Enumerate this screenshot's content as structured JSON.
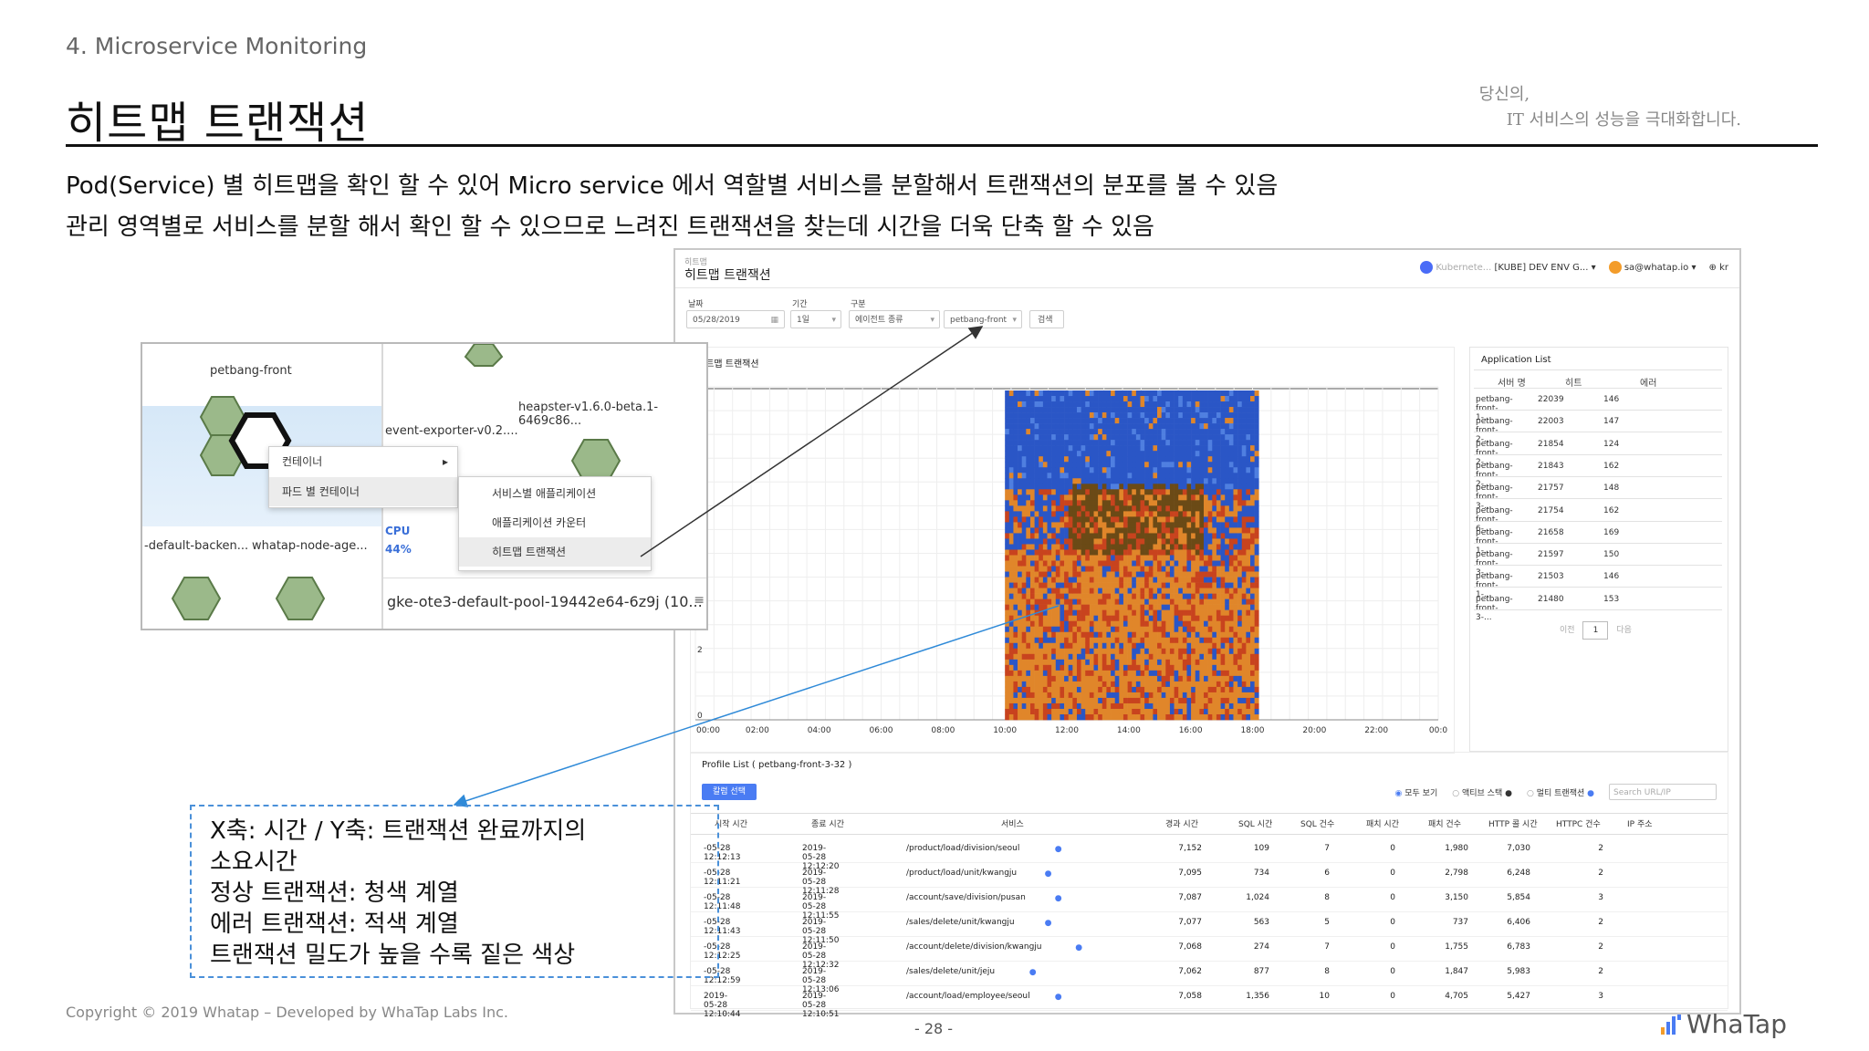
{
  "slide": {
    "section": "4. Microservice Monitoring",
    "title": "히트맵 트랜잭션",
    "tagline_line1": "당신의,",
    "tagline_line2": "IT 서비스의 성능을 극대화합니다.",
    "desc1": "Pod(Service) 별 히트맵을 확인 할 수 있어 Micro service 에서 역할별 서비스를 분할해서 트랜잭션의 분포를 볼 수 있음",
    "desc2": "관리 영역별로 서비스를 분할 해서 확인 할 수 있으므로 느려진 트랜잭션을 찾는데 시간을 더욱 단축 할 수 있음",
    "copyright": "Copyright © 2019 Whatap – Developed by WhaTap Labs Inc.",
    "page": "- 28 -",
    "logo": "WhaTap"
  },
  "annotation": {
    "line1": "X축: 시간 / Y축: 트랜잭션 완료까지의",
    "line2": "소요시간",
    "line3": "정상 트랜잭션: 청색 계열",
    "line4": "에러 트랜잭션: 적색 계열",
    "line5": "트랜잭션 밀도가 높을 수록 짙은 색상"
  },
  "screenshot": {
    "breadcrumb": "히트맵",
    "title": "히트맵 트랜잭션",
    "topbar": {
      "project_short": "Kubernete...",
      "project": "[KUBE] DEV ENV G...",
      "user": "sa@whatap.io",
      "lang": "kr"
    },
    "filters": {
      "date_label": "날짜",
      "date_value": "05/28/2019",
      "period_label": "기간",
      "period_value": "1일",
      "type_label": "구분",
      "type_value": "에이전트 종류",
      "agent_value": "petbang-front",
      "search_button": "검색"
    },
    "heatmap": {
      "title": "히트맵 트랜잭션",
      "x_ticks": [
        "00:00",
        "02:00",
        "04:00",
        "06:00",
        "08:00",
        "10:00",
        "12:00",
        "14:00",
        "16:00",
        "18:00",
        "20:00",
        "22:00",
        "00:0"
      ],
      "y_ticks": [
        "0",
        "2"
      ],
      "colors": {
        "normal": "#2a56c6",
        "normal_light": "#4f7fe0",
        "error": "#e0862a",
        "error_dark": "#c8431e",
        "dense": "#6b4a16"
      }
    },
    "app_list": {
      "title": "Application List",
      "headers": [
        "서버 명",
        "히트",
        "에러"
      ],
      "rows": [
        [
          "petbang-front-1-...",
          "22039",
          "146"
        ],
        [
          "petbang-front-2-...",
          "22003",
          "147"
        ],
        [
          "petbang-front-2-...",
          "21854",
          "124"
        ],
        [
          "petbang-front-2-...",
          "21843",
          "162"
        ],
        [
          "petbang-front-3-...",
          "21757",
          "148"
        ],
        [
          "petbang-front-6-...",
          "21754",
          "162"
        ],
        [
          "petbang-front-1-...",
          "21658",
          "169"
        ],
        [
          "petbang-front-3-...",
          "21597",
          "150"
        ],
        [
          "petbang-front-1-...",
          "21503",
          "146"
        ],
        [
          "petbang-front-3-...",
          "21480",
          "153"
        ]
      ],
      "prev": "이전",
      "page": "1",
      "next": "다음"
    },
    "profile": {
      "title": "Profile List ( petbang-front-3-32 )",
      "select_button": "칼럼 선택",
      "filter_all": "모두 보기",
      "filter_active": "액티브 스택",
      "filter_multi": "멀티 트랜잭션",
      "search_placeholder": "Search URL/IP",
      "headers": [
        "시작 시간",
        "종료 시간",
        "서비스",
        "경과 시간",
        "SQL 시간",
        "SQL 건수",
        "패치 시간",
        "패치 건수",
        "HTTP 콜 시간",
        "HTTPC 건수",
        "IP 주소"
      ],
      "rows": [
        [
          "-05-28 12:12:13",
          "2019-05-28 12:12:20",
          "/product/load/division/seoul",
          "7,152",
          "109",
          "7",
          "0",
          "1,980",
          "7,030",
          "2",
          ""
        ],
        [
          "-05-28 12:11:21",
          "2019-05-28 12:11:28",
          "/product/load/unit/kwangju",
          "7,095",
          "734",
          "6",
          "0",
          "2,798",
          "6,248",
          "2",
          ""
        ],
        [
          "-05-28 12:11:48",
          "2019-05-28 12:11:55",
          "/account/save/division/pusan",
          "7,087",
          "1,024",
          "8",
          "0",
          "3,150",
          "5,854",
          "3",
          ""
        ],
        [
          "-05-28 12:11:43",
          "2019-05-28 12:11:50",
          "/sales/delete/unit/kwangju",
          "7,077",
          "563",
          "5",
          "0",
          "737",
          "6,406",
          "2",
          ""
        ],
        [
          "-05-28 12:12:25",
          "2019-05-28 12:12:32",
          "/account/delete/division/kwangju",
          "7,068",
          "274",
          "7",
          "0",
          "1,755",
          "6,783",
          "2",
          ""
        ],
        [
          "-05-28 12:12:59",
          "2019-05-28 12:13:06",
          "/sales/delete/unit/jeju",
          "7,062",
          "877",
          "8",
          "0",
          "1,847",
          "5,983",
          "2",
          ""
        ],
        [
          "2019-05-28 12:10:44",
          "2019-05-28 12:10:51",
          "/account/load/employee/seoul",
          "7,058",
          "1,356",
          "10",
          "0",
          "4,705",
          "5,427",
          "3",
          ""
        ]
      ]
    }
  },
  "inset": {
    "top_label": "petbang-front",
    "heapster": "heapster-v1.6.0-beta.1-6469c86...",
    "event_exporter": "event-exporter-v0.2....",
    "cpu_label": "CPU",
    "cpu_value": "44%",
    "left_bottom1": "-default-backen...",
    "left_bottom2": "whatap-node-age...",
    "gke": "gke-ote3-default-pool-19442e64-6z9j (10...",
    "menu": {
      "item1": "컨테이너",
      "item2": "파드 별 컨테이너",
      "sub1": "서비스별 애플리케이션",
      "sub2": "애플리케이션 카운터",
      "sub3": "히트맵 트랜잭션"
    }
  }
}
